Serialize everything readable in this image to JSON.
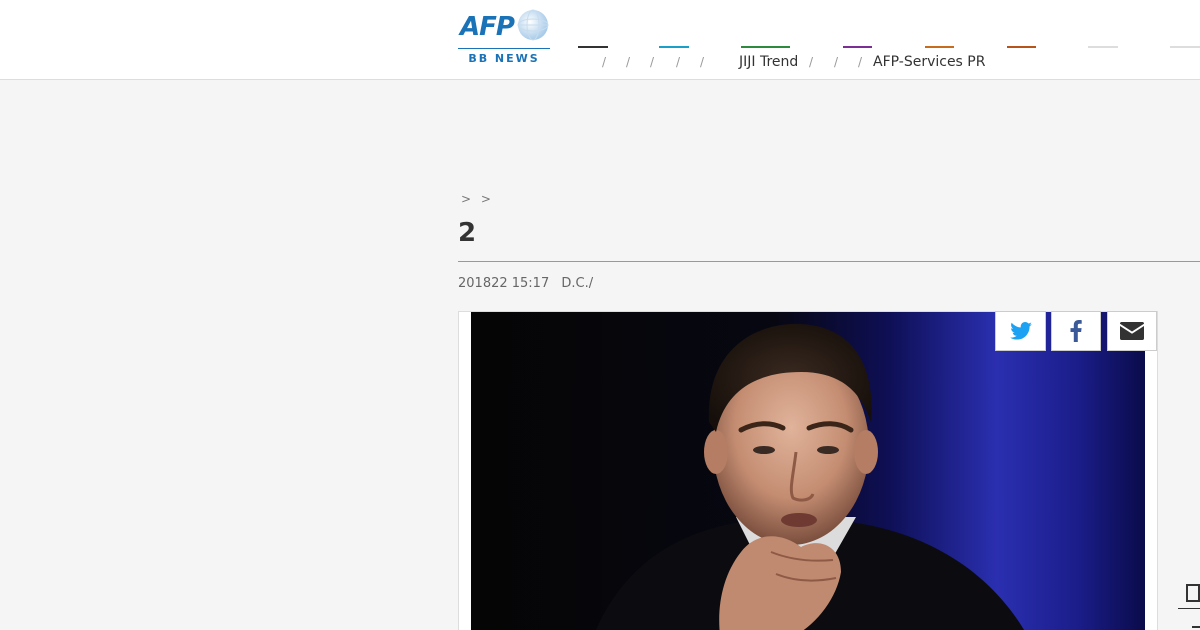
{
  "header": {
    "logo_text": "AFP",
    "logo_sub": "BB NEWS",
    "nav_colors": [
      "#333333",
      "#1a9fc9",
      "#2e8b3e",
      "#7b2f93",
      "#c76b1e",
      "#b7541a",
      "#dddddd",
      "#dddddd"
    ],
    "nav_separators": [
      "/",
      "/",
      "/",
      "/",
      "/",
      "/",
      "/",
      "/"
    ],
    "nav_links": [
      "JIJI Trend",
      "AFP-Services PR"
    ]
  },
  "article": {
    "breadcrumb": "> >",
    "title": "2 ",
    "meta": {
      "date": "201822 15:17",
      "location": "D.C./"
    }
  },
  "share": {
    "twitter_color": "#1da1f2",
    "facebook_color": "#3b5998",
    "mail_color": "#333333"
  }
}
